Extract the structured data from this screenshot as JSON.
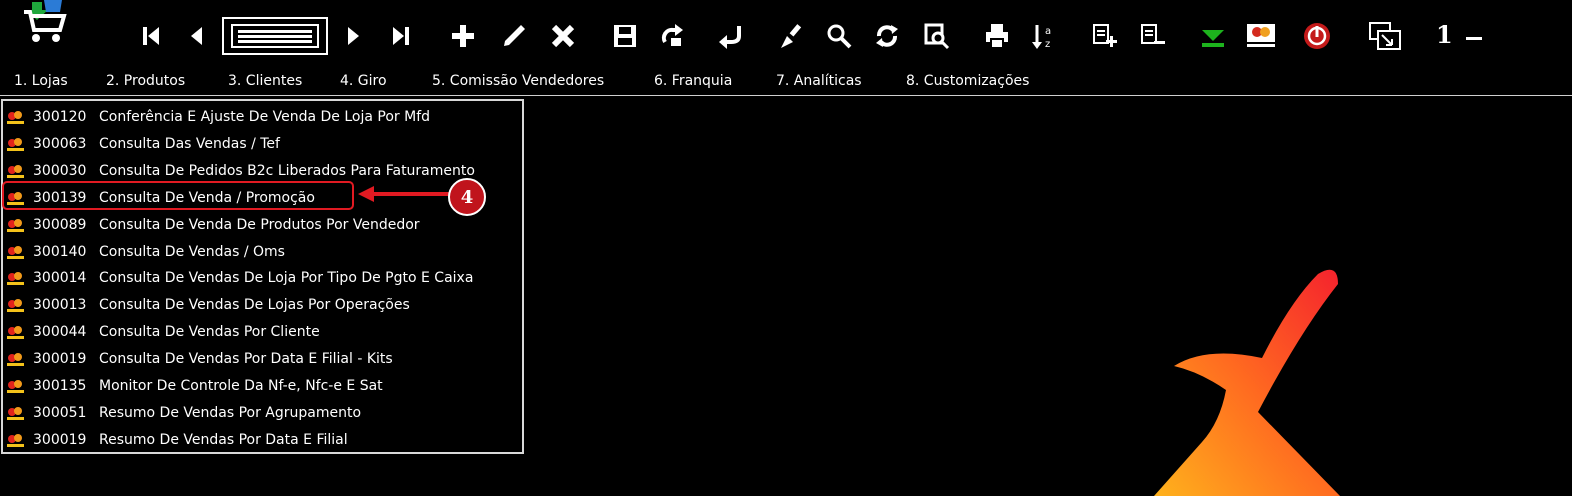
{
  "toolbar": {
    "buttons": [
      "first-record",
      "previous-record",
      "list-view",
      "next-record",
      "last-record",
      "add",
      "edit",
      "delete",
      "save",
      "refresh-forward",
      "undo",
      "clear",
      "search",
      "reload",
      "preview",
      "print",
      "sort",
      "add-item",
      "remove-item",
      "download",
      "image-report",
      "power",
      "window-switch"
    ],
    "page_number": "1"
  },
  "menu": {
    "items": [
      "1. Lojas",
      "2. Produtos",
      "3. Clientes",
      "4. Giro",
      "5. Comissão Vendedores",
      "6. Franquia",
      "7. Analíticas",
      "8. Customizações"
    ]
  },
  "list": {
    "rows": [
      {
        "code": "300120",
        "label": "Conferência E Ajuste De Venda De Loja Por Mfd"
      },
      {
        "code": "300063",
        "label": "Consulta Das Vendas / Tef"
      },
      {
        "code": "300030",
        "label": "Consulta De Pedidos B2c Liberados Para Faturamento"
      },
      {
        "code": "300139",
        "label": "Consulta De Venda / Promoção"
      },
      {
        "code": "300089",
        "label": "Consulta De Venda De Produtos Por Vendedor"
      },
      {
        "code": "300140",
        "label": "Consulta De Vendas / Oms"
      },
      {
        "code": "300014",
        "label": "Consulta De Vendas De Loja Por Tipo De Pgto E Caixa"
      },
      {
        "code": "300013",
        "label": "Consulta De Vendas De Lojas Por Operações"
      },
      {
        "code": "300044",
        "label": "Consulta De Vendas Por Cliente"
      },
      {
        "code": "300019",
        "label": "Consulta De Vendas Por Data E Filial - Kits"
      },
      {
        "code": "300135",
        "label": "Monitor De Controle Da Nf-e, Nfc-e E Sat"
      },
      {
        "code": "300051",
        "label": "Resumo De Vendas Por Agrupamento"
      },
      {
        "code": "300019",
        "label": "Resumo De Vendas Por Data E Filial"
      }
    ]
  },
  "annotation": {
    "step": "4"
  },
  "colors": {
    "accent_red": "#e11a22",
    "background": "#000000",
    "download_green": "#1db31d"
  }
}
